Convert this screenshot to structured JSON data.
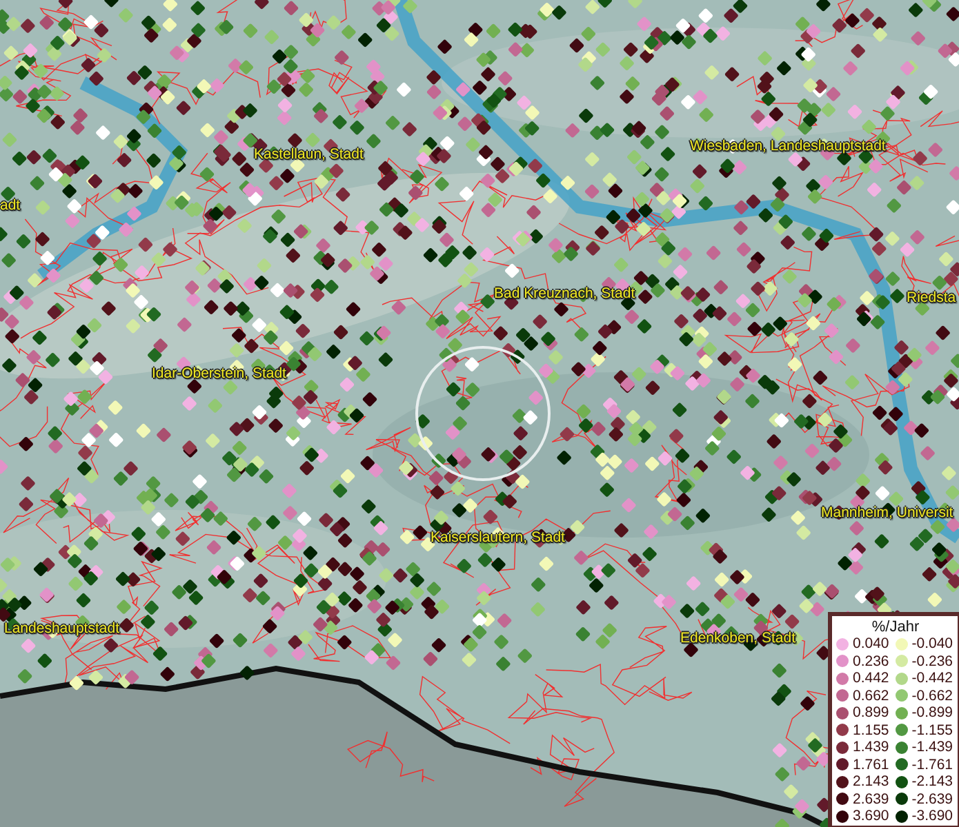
{
  "map": {
    "places": [
      {
        "name": "adt"
      },
      {
        "name": "Kastellaun, Stadt"
      },
      {
        "name": "Wiesbaden, Landeshauptstadt"
      },
      {
        "name": "Riedsta"
      },
      {
        "name": "Bad Kreuznach, Stadt"
      },
      {
        "name": "Idar-Oberstein, Stadt"
      },
      {
        "name": "Kaiserslautern, Stadt"
      },
      {
        "name": "Mannheim, Universit"
      },
      {
        "name": "Edenkoben, Stadt"
      },
      {
        "name": "Landeshauptstadt"
      }
    ]
  },
  "legend": {
    "title": "%/Jahr",
    "rows": [
      {
        "positive": {
          "label": "0.040",
          "color": "#f2b2e2"
        },
        "negative": {
          "label": "-0.040",
          "color": "#f2f8b6"
        }
      },
      {
        "positive": {
          "label": "0.236",
          "color": "#e292c8"
        },
        "negative": {
          "label": "-0.236",
          "color": "#d4eaa2"
        }
      },
      {
        "positive": {
          "label": "0.442",
          "color": "#d27aa8"
        },
        "negative": {
          "label": "-0.442",
          "color": "#b2d88a"
        }
      },
      {
        "positive": {
          "label": "0.662",
          "color": "#c26892"
        },
        "negative": {
          "label": "-0.662",
          "color": "#92c872"
        }
      },
      {
        "positive": {
          "label": "0.899",
          "color": "#aa5070"
        },
        "negative": {
          "label": "-0.899",
          "color": "#72b052"
        }
      },
      {
        "positive": {
          "label": "1.155",
          "color": "#923a4a"
        },
        "negative": {
          "label": "-1.155",
          "color": "#529842"
        }
      },
      {
        "positive": {
          "label": "1.439",
          "color": "#7a2a3a"
        },
        "negative": {
          "label": "-1.439",
          "color": "#3a8232"
        }
      },
      {
        "positive": {
          "label": "1.761",
          "color": "#621a2a"
        },
        "negative": {
          "label": "-1.761",
          "color": "#226a22"
        }
      },
      {
        "positive": {
          "label": "2.143",
          "color": "#52121a"
        },
        "negative": {
          "label": "-2.143",
          "color": "#125212"
        }
      },
      {
        "positive": {
          "label": "2.639",
          "color": "#420a12"
        },
        "negative": {
          "label": "-2.639",
          "color": "#0a3a0a"
        }
      },
      {
        "positive": {
          "label": "3.690",
          "color": "#32020a"
        },
        "negative": {
          "label": "-3.690",
          "color": "#022202"
        }
      }
    ]
  }
}
